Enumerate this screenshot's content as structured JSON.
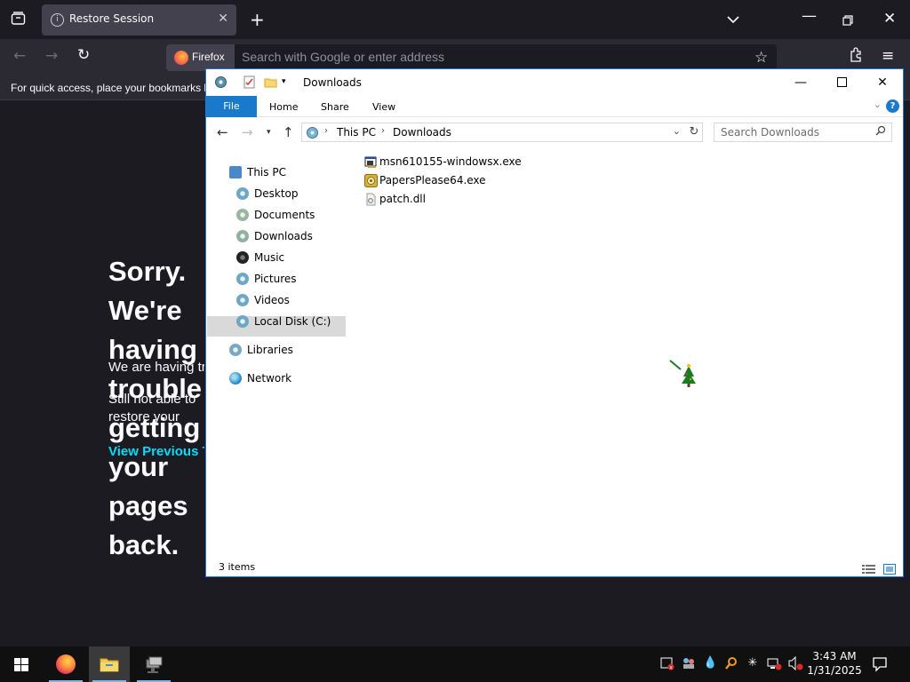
{
  "browser": {
    "tab_title": "Restore Session",
    "identity_label": "Firefox",
    "url_placeholder": "Search with Google or enter address",
    "bookmarks_hint": "For quick access, place your bookmarks h"
  },
  "error_page": {
    "title": "Sorry. We're having trouble getting your pages back.",
    "paragraph1": "We are having trouble restoring your last browsing session.",
    "paragraph2": "Still not able to restore your session? Sometimes a tab is causing the issue. View previous tabs, remove the checkmark from the tabs you don't need to recover, and then restore.",
    "link": "View Previous Tabs"
  },
  "explorer": {
    "title": "Downloads",
    "ribbon_tabs": [
      "File",
      "Home",
      "Share",
      "View"
    ],
    "breadcrumb": [
      "This PC",
      "Downloads"
    ],
    "search_placeholder": "Search Downloads",
    "nav_items": [
      {
        "label": "This PC",
        "icon": "computer-icon"
      },
      {
        "label": "Desktop",
        "icon": "desktop-icon"
      },
      {
        "label": "Documents",
        "icon": "documents-icon"
      },
      {
        "label": "Downloads",
        "icon": "downloads-icon",
        "selected": true
      },
      {
        "label": "Music",
        "icon": "music-icon"
      },
      {
        "label": "Pictures",
        "icon": "pictures-icon"
      },
      {
        "label": "Videos",
        "icon": "videos-icon"
      },
      {
        "label": "Local Disk (C:)",
        "icon": "disk-icon"
      },
      {
        "label": "Libraries",
        "icon": "libraries-icon"
      },
      {
        "label": "Network",
        "icon": "network-icon"
      }
    ],
    "files": [
      {
        "name": "msn610155-windowsx.exe",
        "icon": "installer-icon"
      },
      {
        "name": "PapersPlease64.exe",
        "icon": "game-exe-icon"
      },
      {
        "name": "patch.dll",
        "icon": "dll-icon"
      }
    ],
    "status": "3 items"
  },
  "taskbar": {
    "time": "3:43 AM",
    "date": "1/31/2025",
    "apps": [
      "firefox-icon",
      "file-explorer-icon",
      "network-drive-icon"
    ]
  },
  "colors": {
    "accent": "#1979ca",
    "link": "#00ddff",
    "browser_bg": "#1c1b22"
  }
}
